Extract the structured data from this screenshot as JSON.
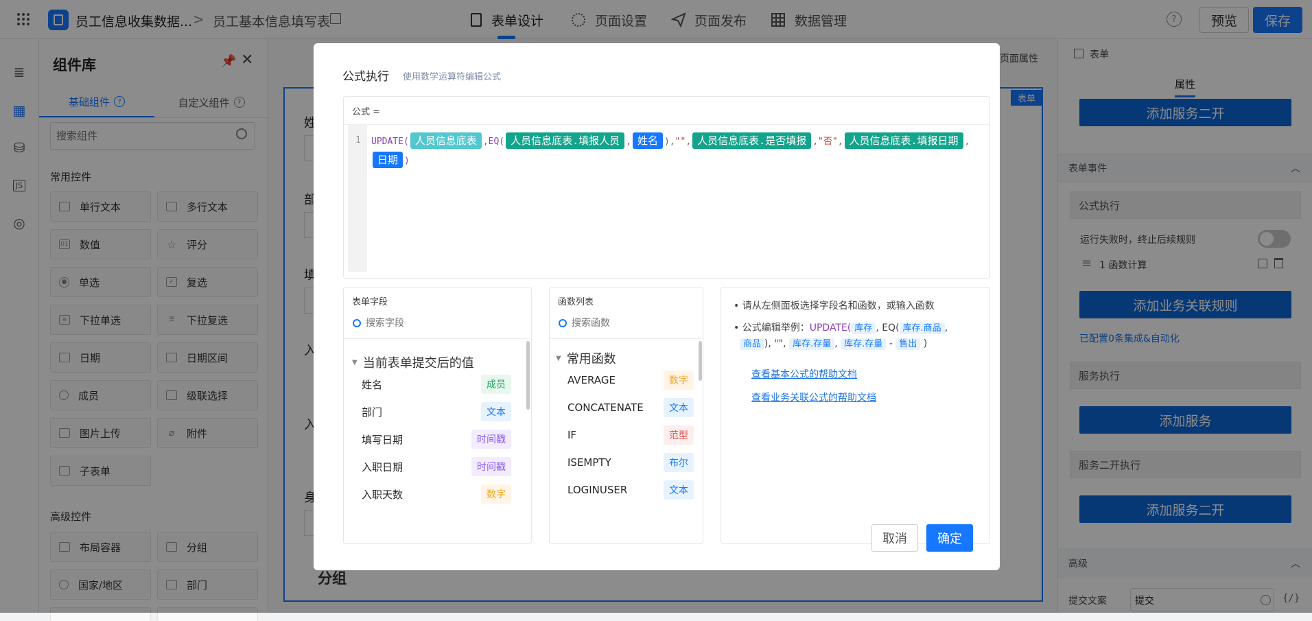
{
  "topbar": {
    "app_title": "员工信息收集数据...",
    "breadcrumb_sep": ">",
    "form_title": "员工基本信息填写表",
    "tabs": [
      {
        "label": "表单设计"
      },
      {
        "label": "页面设置"
      },
      {
        "label": "页面发布"
      },
      {
        "label": "数据管理"
      }
    ],
    "help_icon": "?",
    "preview_label": "预览",
    "save_label": "保存"
  },
  "library": {
    "title": "组件库",
    "tabs": [
      "基础组件",
      "自定义组件"
    ],
    "search_placeholder": "搜索组件",
    "common_title": "常用控件",
    "common": [
      "单行文本",
      "多行文本",
      "数值",
      "评分",
      "单选",
      "复选",
      "下拉单选",
      "下拉复选",
      "日期",
      "日期区间",
      "成员",
      "级联选择",
      "图片上传",
      "附件",
      "子表单"
    ],
    "advanced_title": "高级控件",
    "advanced": [
      "布局容器",
      "分组",
      "国家/地区",
      "部门"
    ]
  },
  "canvas": {
    "page_attr_label": "页面属性",
    "form_badge": "表单",
    "group_label": "分组",
    "field_initials": [
      "姓",
      "部",
      "填",
      "入",
      "入",
      "身"
    ]
  },
  "right_panel": {
    "header": "表单",
    "tab": "属性",
    "btn_service_dev_top": "添加服务二开",
    "form_events": "表单事件",
    "formula_exec": "公式执行",
    "fail_stop": "运行失败时，终止后续规则",
    "func_calc": "1 函数计算",
    "add_rule": "添加业务关联规则",
    "configured": "已配置0条集成&自动化",
    "service_exec": "服务执行",
    "add_service": "添加服务",
    "service_dev_exec": "服务二开执行",
    "add_service_dev": "添加服务二开",
    "advanced": "高级",
    "submit_label": "提交文案",
    "submit_value": "提交"
  },
  "modal": {
    "title": "公式执行",
    "subtitle": "使用数学运算符编辑公式",
    "formula_label": "公式 =",
    "line_no": "1",
    "formula": {
      "fn1": "UPDATE(",
      "tag1": "人员信息底表",
      "comma1": ",",
      "fn2": "EQ(",
      "tag2": "人员信息底表.填报人员",
      "comma2": ",",
      "tag3": "姓名",
      "close1": "),",
      "str1": "\"\"",
      "comma3": ",",
      "tag4": "人员信息底表.是否填报",
      "comma4": ",",
      "str2": "\"否\"",
      "comma5": ",",
      "tag5": "人员信息底表.填报日期",
      "comma6": ",",
      "tag6": "日期",
      "close2": ")"
    },
    "fields_title": "表单字段",
    "fields_search": "搜索字段",
    "fields_group": "当前表单提交后的值",
    "fields": [
      {
        "name": "姓名",
        "type": "成员"
      },
      {
        "name": "部门",
        "type": "文本"
      },
      {
        "name": "填写日期",
        "type": "时间戳"
      },
      {
        "name": "入职日期",
        "type": "时间戳"
      },
      {
        "name": "入职天数",
        "type": "数字"
      }
    ],
    "funcs_title": "函数列表",
    "funcs_search": "搜索函数",
    "funcs_group": "常用函数",
    "funcs": [
      {
        "name": "AVERAGE",
        "type": "数字"
      },
      {
        "name": "CONCATENATE",
        "type": "文本"
      },
      {
        "name": "IF",
        "type": "范型"
      },
      {
        "name": "ISEMPTY",
        "type": "布尔"
      },
      {
        "name": "LOGINUSER",
        "type": "文本"
      }
    ],
    "help": {
      "tip1": "请从左侧面板选择字段名和函数，或输入函数",
      "tip2_prefix": "公式编辑举例：",
      "ex_fn1": "UPDATE(",
      "ex_t1": "库存",
      "ex_sep1": ", EQ(",
      "ex_t2": "库存.商品",
      "ex_sep2": ",",
      "ex_t3": "商品",
      "ex_sep3": "), \"\",",
      "ex_t4": "库存.存量",
      "ex_sep4": ",",
      "ex_t5": "库存.存量",
      "ex_sep5": "-",
      "ex_t6": "售出",
      "ex_end": ")",
      "link1": "查看基本公式的帮助文档",
      "link2": "查看业务关联公式的帮助文档"
    },
    "cancel": "取消",
    "confirm": "确定"
  }
}
